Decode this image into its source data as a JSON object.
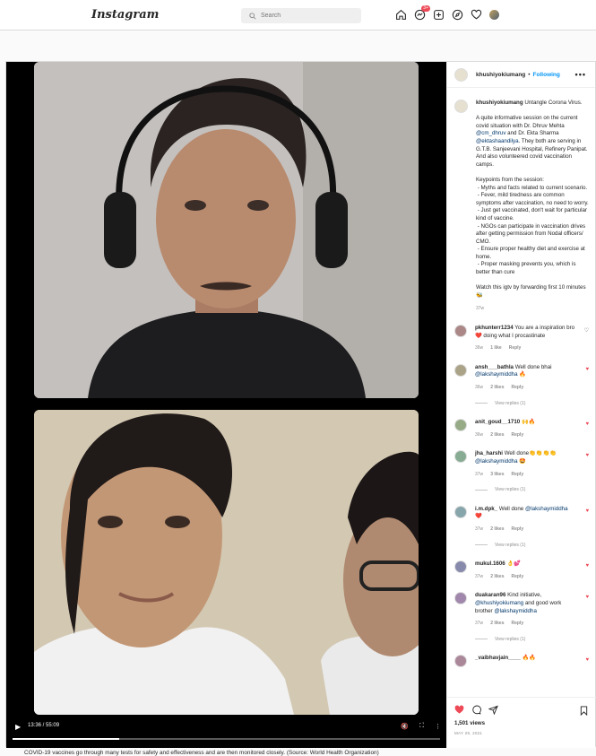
{
  "topbar": {
    "logo": "Instagram",
    "search_placeholder": "Search",
    "notification_count": "3+",
    "icons": [
      "home-icon",
      "messenger-icon",
      "new-post-icon",
      "explore-icon",
      "activity-heart-icon",
      "profile-avatar"
    ]
  },
  "video": {
    "time": "13:36 / 55:09",
    "progress": 0.25
  },
  "sidebar": {
    "username": "khushiyokiumang",
    "dot": "•",
    "follow_status": "Following",
    "more": "•••",
    "caption": {
      "username": "khushiyokiumang",
      "title": "Untangle Corona Virus.",
      "p1a": "A quite informative session on the current covid situation with Dr. Dhruv Mehta ",
      "m1": "@cm_dhruv",
      "p1b": " and Dr. Ekta Sharma ",
      "m2": "@ektashaandilya",
      "p1c": ". They both are serving in G.T.B. Sanjeevani Hospital, Refinery Panipat. And also volunteered covid vaccination camps.",
      "p2": "Keypoints from the session:\n - Myths and facts related to current scenario.\n - Fever, mild tiredness are common symptoms after vaccination, no need to worry.\n - Just get vaccinated, don't wait for particular kind of vaccine.\n - NGOs can participate in vaccination drives after getting permission from Nodal officers/ CMO.\n - Ensure proper healthy diet and exercise at home.\n - Proper masking prevents you, which is better than cure",
      "p3": "Watch this igtv by forwarding first 10 minutes 🐝",
      "age": "37w"
    },
    "comments": [
      {
        "user": "pkhunterr1234",
        "text": "You are a inspiration bro ❤️ doing what I procastinate",
        "age": "36w",
        "likes": "1 like",
        "reply": "Reply",
        "liked": false,
        "view_replies": ""
      },
      {
        "user": "ansh___bathla",
        "text": "Well done bhai",
        "mention": "@lakshaymiddha",
        "emoji": " 🔥",
        "age": "36w",
        "likes": "2 likes",
        "reply": "Reply",
        "liked": true,
        "view_replies": "View replies (1)"
      },
      {
        "user": "anit_goud__1710",
        "text": "🙌🔥",
        "age": "36w",
        "likes": "2 likes",
        "reply": "Reply",
        "liked": true,
        "view_replies": ""
      },
      {
        "user": "jha_harshi",
        "text": "Well done👏👏👏👏",
        "mention": "@lakshaymiddha",
        "emoji": " 🤩",
        "age": "37w",
        "likes": "3 likes",
        "reply": "Reply",
        "liked": true,
        "view_replies": "View replies (1)"
      },
      {
        "user": "i.m.dpk_",
        "text": "Well done",
        "mention": "@lakshaymiddha",
        "emoji": " ❤️",
        "age": "37w",
        "likes": "2 likes",
        "reply": "Reply",
        "liked": true,
        "view_replies": "View replies (1)"
      },
      {
        "user": "mukul.1606",
        "text": "👌💕",
        "age": "37w",
        "likes": "2 likes",
        "reply": "Reply",
        "liked": true,
        "view_replies": ""
      },
      {
        "user": "duakaran96",
        "text": "Kind initiative,",
        "mention": "@khushiyokiumang",
        "text2": " and good work brother ",
        "mention2": "@lakshaymiddha",
        "age": "37w",
        "likes": "2 likes",
        "reply": "Reply",
        "liked": true,
        "view_replies": "View replies (1)"
      },
      {
        "user": "_vaibhavjain____",
        "text": "🔥🔥",
        "age": "",
        "likes": "",
        "reply": "",
        "liked": true,
        "view_replies": ""
      }
    ],
    "views": "1,501 views",
    "date": "MAY 29, 2021"
  },
  "bottom_caption": "COVID-19 vaccines go through many tests for safety and effectiveness and are then monitored closely. (Source: World Health Organization)",
  "colors": {
    "like": "#ed4956",
    "link": "#00376b",
    "follow": "#0095f6"
  }
}
